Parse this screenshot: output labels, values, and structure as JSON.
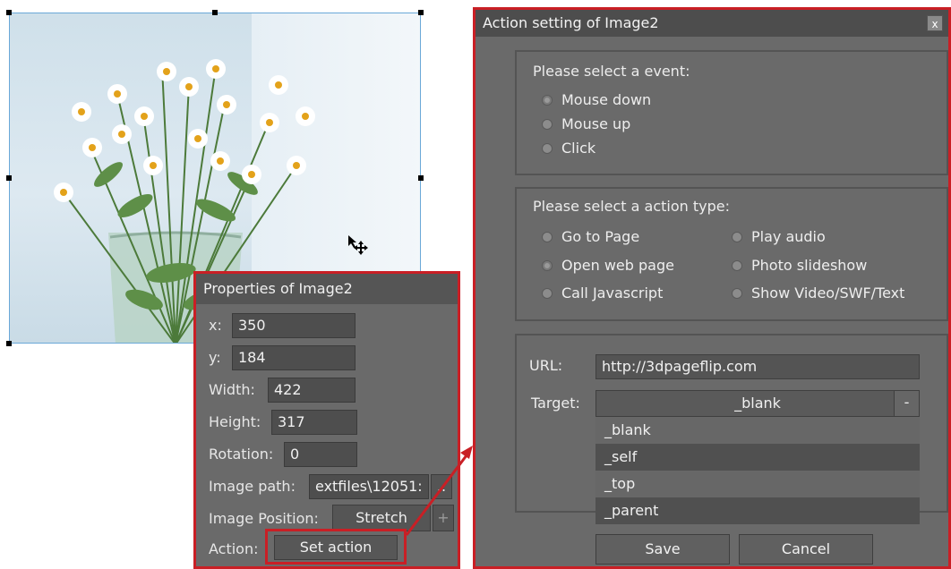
{
  "properties": {
    "title": "Properties of Image2",
    "x_label": "x:",
    "x_value": "350",
    "y_label": "y:",
    "y_value": "184",
    "width_label": "Width:",
    "width_value": "422",
    "height_label": "Height:",
    "height_value": "317",
    "rotation_label": "Rotation:",
    "rotation_value": "0",
    "image_path_label": "Image path:",
    "image_path_value": "extfiles\\12051:",
    "browse_label": "..",
    "image_position_label": "Image Position:",
    "image_position_value": "Stretch",
    "image_position_btn": "+",
    "action_label": "Action:",
    "set_action_label": "Set action"
  },
  "dialog": {
    "title": "Action setting of Image2",
    "close_label": "x",
    "event_group": {
      "heading": "Please select a event:",
      "options": [
        "Mouse down",
        "Mouse up",
        "Click"
      ]
    },
    "action_group": {
      "heading": "Please select a action type:",
      "left": [
        "Go to Page",
        "Open web page",
        "Call Javascript"
      ],
      "right": [
        "Play audio",
        "Photo slideshow",
        "Show Video/SWF/Text"
      ]
    },
    "url_label": "URL:",
    "url_value": "http://3dpageflip.com",
    "target_label": "Target:",
    "target_value": "_blank",
    "target_arrow": "-",
    "target_options": [
      "_blank",
      "_self",
      "_top",
      "_parent"
    ],
    "save_label": "Save",
    "cancel_label": "Cancel"
  }
}
